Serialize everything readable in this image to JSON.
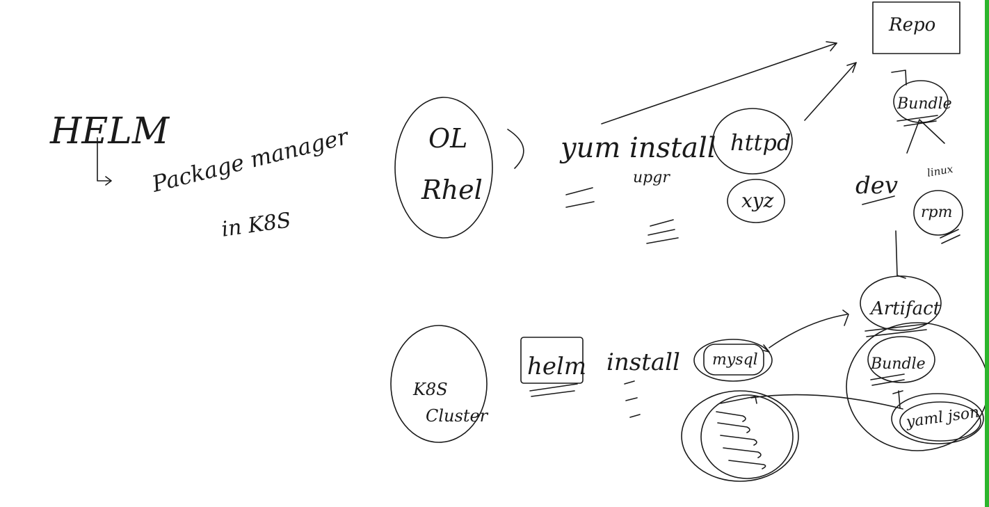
{
  "colors": {
    "ink": "#1a1a1a",
    "edge_bar": "#2db52d",
    "background": "#ffffff"
  },
  "notes": {
    "title": "HELM",
    "subtitle": "Package manager",
    "context": "in K8S"
  },
  "top_flow": {
    "os_line1": "OL",
    "os_line2": "Rhel",
    "command": "yum install",
    "sub_command": "upgr",
    "package_1": "httpd",
    "package_2": "xyz",
    "repo": "Repo",
    "bundle": "Bundle",
    "dev": "dev",
    "linux": "linux",
    "rpm": "rpm"
  },
  "bottom_flow": {
    "cluster_line1": "K8S",
    "cluster_line2": "Cluster",
    "tool": "helm",
    "command": "install",
    "chart": "mysql",
    "artifact": "Artifact",
    "bundle": "Bundle",
    "files": "yaml json"
  }
}
